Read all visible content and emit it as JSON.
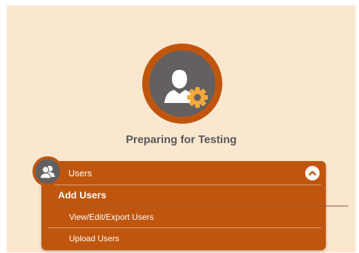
{
  "colors": {
    "page_background": "#fbe7cf",
    "accent": "#c0560e",
    "icon_circle": "#63605f",
    "gear": "#f4a93b",
    "text_title": "#58585b",
    "text_on_accent": "#ffffff"
  },
  "hero": {
    "icon": "user-gear-icon",
    "title": "Preparing for Testing"
  },
  "menu": {
    "icon": "users-icon",
    "header_label": "Users",
    "toggle_icon": "chevron-up-icon",
    "expanded": true,
    "submenu": {
      "label": "Add Users",
      "items": [
        {
          "label": "View/Edit/Export Users"
        },
        {
          "label": "Upload Users"
        }
      ]
    }
  }
}
